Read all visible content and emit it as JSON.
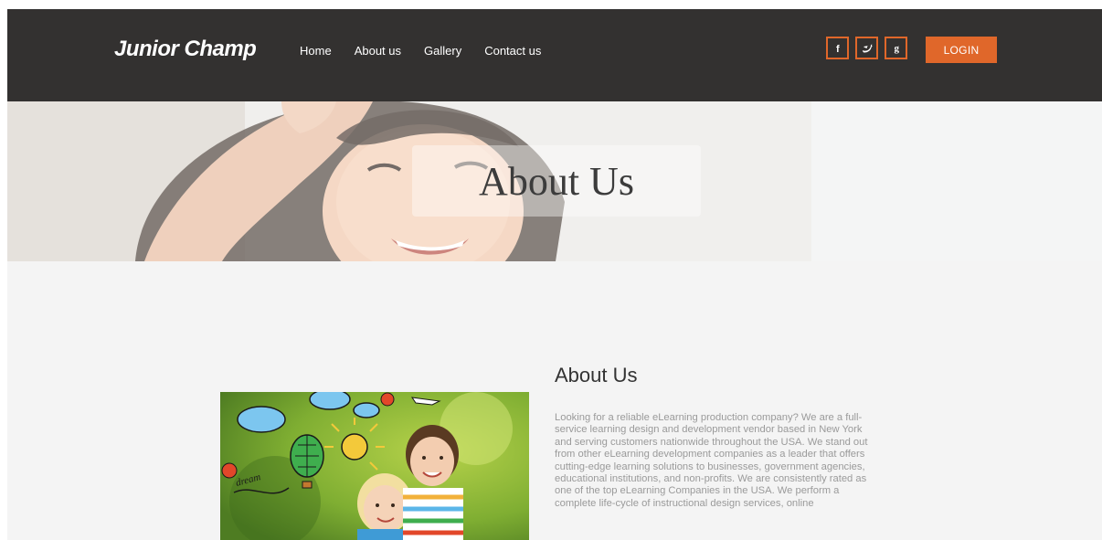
{
  "header": {
    "brand": "Junior Champ",
    "nav": [
      "Home",
      "About us",
      "Gallery",
      "Contact us"
    ],
    "socials": [
      {
        "name": "facebook",
        "glyph": "f"
      },
      {
        "name": "twitter",
        "glyph": "bird"
      },
      {
        "name": "google-plus",
        "glyph": "g"
      }
    ],
    "login_label": "LOGIN",
    "accent_color": "#e0672a",
    "bg_color": "#333130"
  },
  "hero": {
    "title": "About Us"
  },
  "about": {
    "heading": "About Us",
    "text": "Looking for a reliable eLearning production company? We are a full-service learning design and development vendor based in New York and serving customers nationwide throughout the USA. We stand out from other eLearning development companies as a leader that offers cutting-edge learning solutions to businesses, government agencies, educational institutions, and non-profits. We are consistently rated as one of the top eLearning Companies in the USA. We perform a complete life-cycle of instructional design services, online"
  }
}
